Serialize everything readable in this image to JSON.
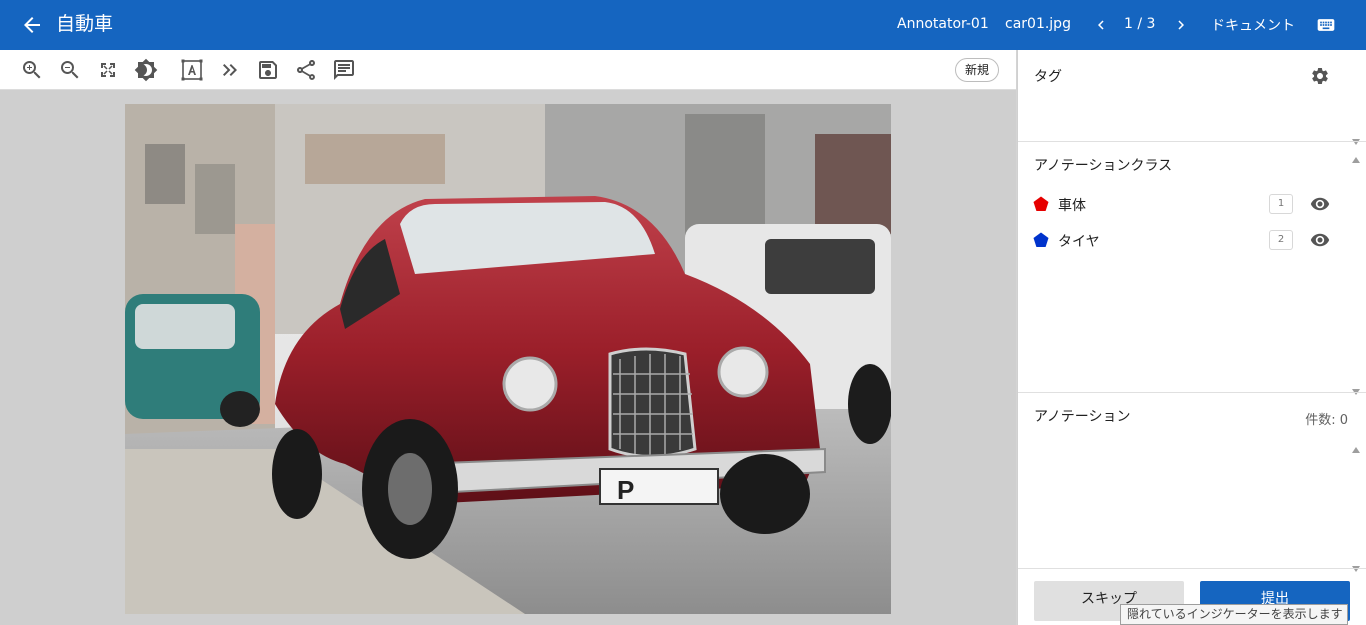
{
  "header": {
    "title": "自動車",
    "annotator": "Annotator-01",
    "file_name": "car01.jpg",
    "page": "1 / 3",
    "document_label": "ドキュメント"
  },
  "toolbar": {
    "tools": [
      "zoom-in",
      "zoom-out",
      "fit-screen",
      "brightness",
      "text-annotation",
      "next-double-chevron",
      "save",
      "share",
      "comment"
    ],
    "new_label": "新規"
  },
  "panel": {
    "tags_title": "タグ",
    "classes_title": "アノテーションクラス",
    "classes": [
      {
        "name": "車体",
        "key": "1",
        "color": "#e60000"
      },
      {
        "name": "タイヤ",
        "key": "2",
        "color": "#0033cc"
      }
    ],
    "annotations_title": "アノテーション",
    "annotations_count": "件数: 0",
    "skip_label": "スキップ",
    "submit_label": "提出"
  },
  "tooltip": "隠れているインジケーターを表示します",
  "colors": {
    "header_bg": "#1565c0",
    "submit_bg": "#1565c0",
    "skip_bg": "#e0e0e0"
  }
}
